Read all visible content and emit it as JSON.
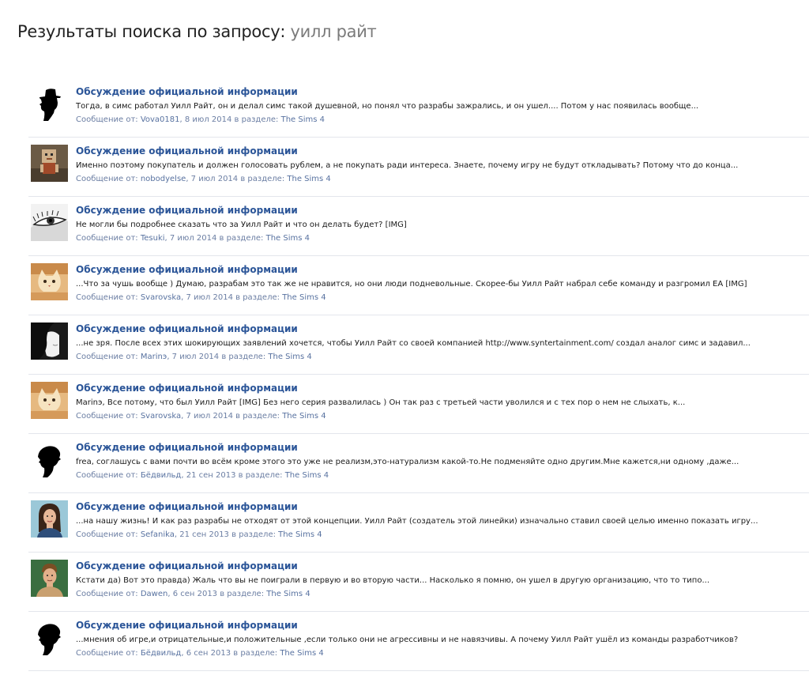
{
  "page": {
    "heading": "Результаты поиска по запросу:",
    "query": "уилл райт"
  },
  "labels": {
    "posted_by": "Сообщение от:",
    "in_section": "в разделе:"
  },
  "results": [
    {
      "title": "Обсуждение официальной информации",
      "snippet": "Тогда, в симс работал Уилл Райт, он и делал симс такой душевной, но понял что разрабы зажрались, и он ушел.... Потом у нас появилась вообще...",
      "author": "Vova0181",
      "date": "8 июл 2014",
      "section": "The Sims 4",
      "avatar": "silhouette-man-hat"
    },
    {
      "title": "Обсуждение официальной информации",
      "snippet": "Именно поэтому покупатель и должен голосовать рублем, а не покупать ради интереса. Знаете, почему игру не будут откладывать? Потому что до конца...",
      "author": "nobodyelse",
      "date": "7 июл 2014",
      "section": "The Sims 4",
      "avatar": "box-head-figure"
    },
    {
      "title": "Обсуждение официальной информации",
      "snippet": "Не могли бы подробнее сказать что за Уилл Райт и что он делать будет? [IMG]",
      "author": "Tesuki",
      "date": "7 июл 2014",
      "section": "The Sims 4",
      "avatar": "eye-sketch"
    },
    {
      "title": "Обсуждение официальной информации",
      "snippet": "...Что за чушь вообще ) Думаю, разрабам это так же не нравится, но они люди подневольные. Скорее-бы Уилл Райт набрал себе команду и разгромил EA [IMG]",
      "author": "Svarovska",
      "date": "7 июл 2014",
      "section": "The Sims 4",
      "avatar": "cat"
    },
    {
      "title": "Обсуждение официальной информации",
      "snippet": "...не зря. После всех этих шокирующих заявлений хочется, чтобы Уилл Райт со своей компанией http://www.syntertainment.com/ создал аналог симс и задавил...",
      "author": "Marinэ",
      "date": "7 июл 2014",
      "section": "The Sims 4",
      "avatar": "dark-hair-portrait"
    },
    {
      "title": "Обсуждение официальной информации",
      "snippet": "Marinэ, Все потому, что был Уилл Райт [IMG] Без него серия развалилась ) Он так раз с третьей части уволился и с тех пор о нем не слыхать, к...",
      "author": "Svarovska",
      "date": "7 июл 2014",
      "section": "The Sims 4",
      "avatar": "cat"
    },
    {
      "title": "Обсуждение официальной информации",
      "snippet": "frea, соглашусь с вами почти во всём кроме этого это уже не реализм,это-натурализм какой-то.Не подменяйте одно другим.Мне кажется,ни одному ,даже...",
      "author": "Бёдвильд",
      "date": "21 сен 2013",
      "section": "The Sims 4",
      "avatar": "silhouette-woman"
    },
    {
      "title": "Обсуждение официальной информации",
      "snippet": "...на нашу жизнь! И как раз разрабы не отходят от этой концепции. Уилл Райт (создатель этой линейки) изначально ставил своей целью именно показать игру...",
      "author": "Sefanika",
      "date": "21 сен 2013",
      "section": "The Sims 4",
      "avatar": "sim-woman"
    },
    {
      "title": "Обсуждение официальной информации",
      "snippet": "Кстати да) Вот это правда) Жаль что вы не поиграли в первую и во вторую части... Насколько я помню, он ушел в другую организацию, что то типо...",
      "author": "Dawen",
      "date": "6 сен 2013",
      "section": "The Sims 4",
      "avatar": "sim-man"
    },
    {
      "title": "Обсуждение официальной информации",
      "snippet": "...мнения об игре,и отрицательные,и положительные ,если только они не агрессивны и не навязчивы. А почему Уилл Райт ушёл из команды разработчиков?",
      "author": "Бёдвильд",
      "date": "6 сен 2013",
      "section": "The Sims 4",
      "avatar": "silhouette-woman"
    }
  ]
}
